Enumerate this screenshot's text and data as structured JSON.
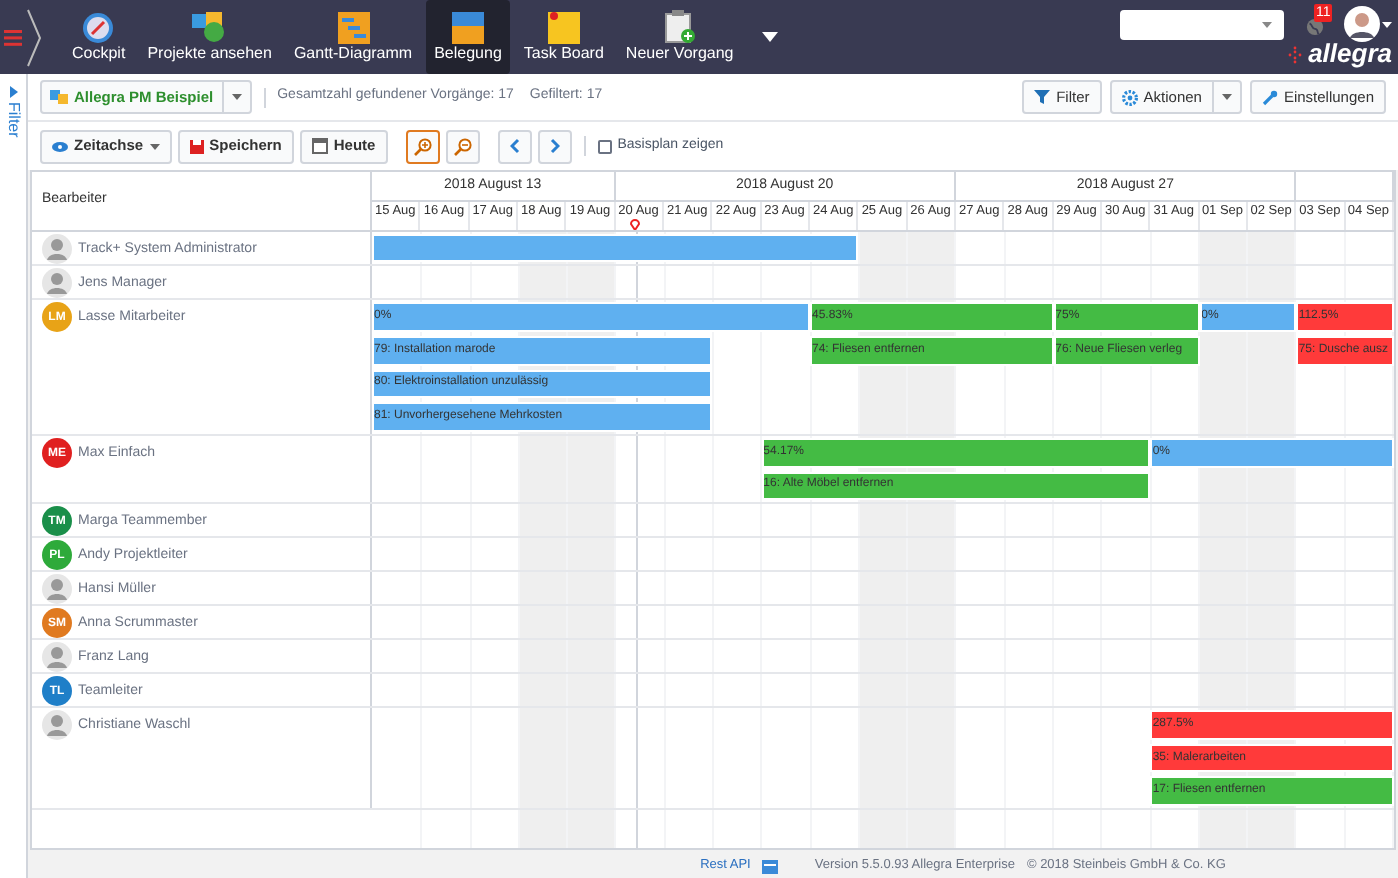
{
  "nav": {
    "items": [
      {
        "label": "Cockpit",
        "selected": false
      },
      {
        "label": "Projekte ansehen",
        "selected": false
      },
      {
        "label": "Gantt-Diagramm",
        "selected": false
      },
      {
        "label": "Belegung",
        "selected": true
      },
      {
        "label": "Task Board",
        "selected": false
      },
      {
        "label": "Neuer Vorgang",
        "selected": false
      }
    ],
    "notification_count": "11",
    "logo": "allegra"
  },
  "side_panel": {
    "label": "Filter"
  },
  "toolbar": {
    "project": "Allegra PM Beispiel",
    "total": "Gesamtzahl gefundener Vorgänge: 17",
    "filtered": "Gefiltert: 17",
    "buttons": [
      "Filter",
      "Aktionen",
      "Einstellungen"
    ]
  },
  "timeline_toolbar": {
    "view": "Zeitachse",
    "save": "Speichern",
    "today": "Heute",
    "zoom_in_selected": true,
    "baseline": {
      "label": "Basisplan zeigen",
      "checked": false
    }
  },
  "gantt": {
    "column_header": "Bearbeiter",
    "weeks": [
      {
        "label": "2018 August 13",
        "days": [
          {
            "label": "15 Aug",
            "weekend": false,
            "today": false
          },
          {
            "label": "16 Aug",
            "weekend": false,
            "today": false
          },
          {
            "label": "17 Aug",
            "weekend": false,
            "today": false
          },
          {
            "label": "18 Aug",
            "weekend": true,
            "today": false
          },
          {
            "label": "19 Aug",
            "weekend": true,
            "today": false
          }
        ]
      },
      {
        "label": "2018 August 20",
        "days": [
          {
            "label": "20 Aug",
            "weekend": false,
            "today": true
          },
          {
            "label": "21 Aug",
            "weekend": false,
            "today": false
          },
          {
            "label": "22 Aug",
            "weekend": false,
            "today": false
          },
          {
            "label": "23 Aug",
            "weekend": false,
            "today": false
          },
          {
            "label": "24 Aug",
            "weekend": false,
            "today": false
          },
          {
            "label": "25 Aug",
            "weekend": true,
            "today": false
          },
          {
            "label": "26 Aug",
            "weekend": true,
            "today": false
          }
        ]
      },
      {
        "label": "2018 August 27",
        "days": [
          {
            "label": "27 Aug",
            "weekend": false,
            "today": false
          },
          {
            "label": "28 Aug",
            "weekend": false,
            "today": false
          },
          {
            "label": "29 Aug",
            "weekend": false,
            "today": false
          },
          {
            "label": "30 Aug",
            "weekend": false,
            "today": false
          },
          {
            "label": "31 Aug",
            "weekend": false,
            "today": false
          },
          {
            "label": "01 Sep",
            "weekend": true,
            "today": false
          },
          {
            "label": "02 Sep",
            "weekend": true,
            "today": false
          }
        ]
      },
      {
        "days": [
          {
            "label": "03 Sep",
            "weekend": false,
            "today": false
          },
          {
            "label": "04 Sep",
            "weekend": false,
            "today": false
          }
        ]
      }
    ],
    "people": [
      {
        "name": "Track+ System Administrator",
        "avatar": {
          "kind": "photo"
        },
        "lanes": [
          [
            {
              "color": "#5fb0f0"
            }
          ]
        ]
      },
      {
        "name": "Jens Manager",
        "avatar": {
          "kind": "photo"
        }
      },
      {
        "name": "Lasse Mitarbeiter",
        "avatar": {
          "kind": "initials",
          "text": "LM",
          "color": "#e8a317"
        },
        "lanes": [
          [
            {
              "label": "0%",
              "color": "#5fb0f0"
            },
            {
              "label": "45.83%",
              "color": "#44bb44"
            },
            {
              "label": "75%",
              "color": "#44bb44"
            },
            {
              "label": "0%",
              "color": "#5fb0f0"
            },
            {
              "label": "112.5%",
              "color": "#ff3a3a"
            }
          ],
          [
            {
              "label": "79: Installation marode",
              "color": "#5fb0f0"
            },
            {
              "label": "74: Fliesen entfernen",
              "color": "#44bb44"
            },
            {
              "label": "76: Neue Fliesen verleg",
              "color": "#44bb44"
            },
            {
              "label": "75: Dusche ausz",
              "color": "#ff3a3a"
            }
          ],
          [
            {
              "label": "80: Elektroinstallation unzulässig",
              "color": "#5fb0f0"
            }
          ],
          [
            {
              "label": "81: Unvorhergesehene Mehrkosten",
              "color": "#5fb0f0"
            }
          ]
        ]
      },
      {
        "name": "Max Einfach",
        "avatar": {
          "kind": "initials",
          "text": "ME",
          "color": "#e02020"
        },
        "lanes": [
          [
            {
              "label": "54.17%",
              "color": "#44bb44"
            },
            {
              "label": "0%",
              "color": "#5fb0f0"
            }
          ],
          [
            {
              "label": "16: Alte Möbel entfernen",
              "color": "#44bb44"
            }
          ]
        ]
      },
      {
        "name": "Marga Teammember",
        "avatar": {
          "kind": "initials",
          "text": "TM",
          "color": "#1a8f4a"
        }
      },
      {
        "name": "Andy Projektleiter",
        "avatar": {
          "kind": "initials",
          "text": "PL",
          "color": "#2eaa3a"
        }
      },
      {
        "name": "Hansi Müller",
        "avatar": {
          "kind": "photo"
        }
      },
      {
        "name": "Anna Scrummaster",
        "avatar": {
          "kind": "initials",
          "text": "SM",
          "color": "#e07a20"
        }
      },
      {
        "name": "Franz Lang",
        "avatar": {
          "kind": "photo"
        }
      },
      {
        "name": "Teamleiter",
        "avatar": {
          "kind": "initials",
          "text": "TL",
          "color": "#1f7fc8"
        }
      },
      {
        "name": "Christiane Waschl",
        "avatar": {
          "kind": "photo"
        },
        "lanes": [
          [
            {
              "label": "287.5%",
              "color": "#ff3a3a"
            }
          ],
          [
            {
              "label": "35: Malerarbeiten",
              "color": "#ff3a3a"
            }
          ],
          [
            {
              "label": "17: Fliesen entfernen",
              "color": "#44bb44"
            }
          ]
        ]
      }
    ]
  },
  "footer": {
    "link": "Rest API",
    "version": "Version 5.5.0.93 Allegra Enterprise",
    "copyright": "© 2018 Steinbeis GmbH & Co. KG"
  }
}
